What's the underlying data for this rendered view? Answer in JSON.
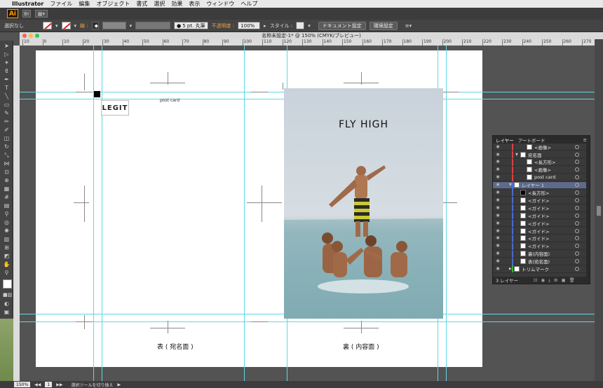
{
  "menubar": {
    "apple": "",
    "app": "Illustrator",
    "items": [
      "ファイル",
      "編集",
      "オブジェクト",
      "書式",
      "選択",
      "効果",
      "表示",
      "ウィンドウ",
      "ヘルプ"
    ]
  },
  "appbar": {
    "logo": "Ai",
    "br": "Br",
    "arrange": "▦▾"
  },
  "control": {
    "selection": "選択なし",
    "stroke_label": "線 :",
    "brush": "5 pt. 丸筆",
    "opacity_label": "不透明度 :",
    "opacity_value": "100%",
    "style_label": "スタイル :",
    "doc_settings": "ドキュメント設定",
    "env_settings": "環境設定"
  },
  "document": {
    "title": "名称未設定-1* @ 150% (CMYK/プレビュー)"
  },
  "ruler": {
    "marks": [
      "10",
      "0",
      "10",
      "20",
      "30",
      "40",
      "50",
      "60",
      "70",
      "80",
      "90",
      "100",
      "110",
      "120",
      "130",
      "140",
      "150",
      "160",
      "170",
      "180",
      "190",
      "200",
      "210",
      "220",
      "230",
      "240",
      "250",
      "260",
      "270",
      "280",
      "290",
      "300"
    ]
  },
  "artboard": {
    "logo": "LEGIT",
    "postcard_label": "post card",
    "headline": "FLY HIGH",
    "caption_front": "表 ( 宛名面 )",
    "caption_back": "裏 ( 内容面 )"
  },
  "layers_panel": {
    "tab_layers": "レイヤー",
    "tab_artboards": "アートボード",
    "footer": "3 レイヤー",
    "rows": [
      {
        "name": "<画像>",
        "indent": 2,
        "color": "#e04040"
      },
      {
        "name": "宛名面",
        "indent": 1,
        "color": "#e04040",
        "expand": "▼"
      },
      {
        "name": "<長方形>",
        "indent": 2,
        "color": "#e04040"
      },
      {
        "name": "<画像>",
        "indent": 2,
        "color": "#e04040"
      },
      {
        "name": "post card",
        "indent": 2,
        "color": "#e04040"
      },
      {
        "name": "レイヤー 1",
        "indent": 0,
        "color": "#4a6cd0",
        "expand": "▼",
        "selected": true
      },
      {
        "name": "<長方形>",
        "indent": 1,
        "color": "#4a6cd0",
        "black": true
      },
      {
        "name": "<ガイド>",
        "indent": 1,
        "color": "#4a6cd0"
      },
      {
        "name": "<ガイド>",
        "indent": 1,
        "color": "#4a6cd0"
      },
      {
        "name": "<ガイド>",
        "indent": 1,
        "color": "#4a6cd0"
      },
      {
        "name": "<ガイド>",
        "indent": 1,
        "color": "#4a6cd0"
      },
      {
        "name": "<ガイド>",
        "indent": 1,
        "color": "#4a6cd0"
      },
      {
        "name": "<ガイド>",
        "indent": 1,
        "color": "#4a6cd0"
      },
      {
        "name": "<ガイド>",
        "indent": 1,
        "color": "#4a6cd0"
      },
      {
        "name": "裏(内容面)",
        "indent": 1,
        "color": "#4a6cd0"
      },
      {
        "name": "表(宛名面)",
        "indent": 1,
        "color": "#4a6cd0"
      },
      {
        "name": "トリムマーク",
        "indent": 0,
        "color": "#30b030",
        "expand": "▶"
      }
    ]
  },
  "status": {
    "zoom": "150%",
    "page": "1",
    "message": "選択ツールを切り換え"
  }
}
